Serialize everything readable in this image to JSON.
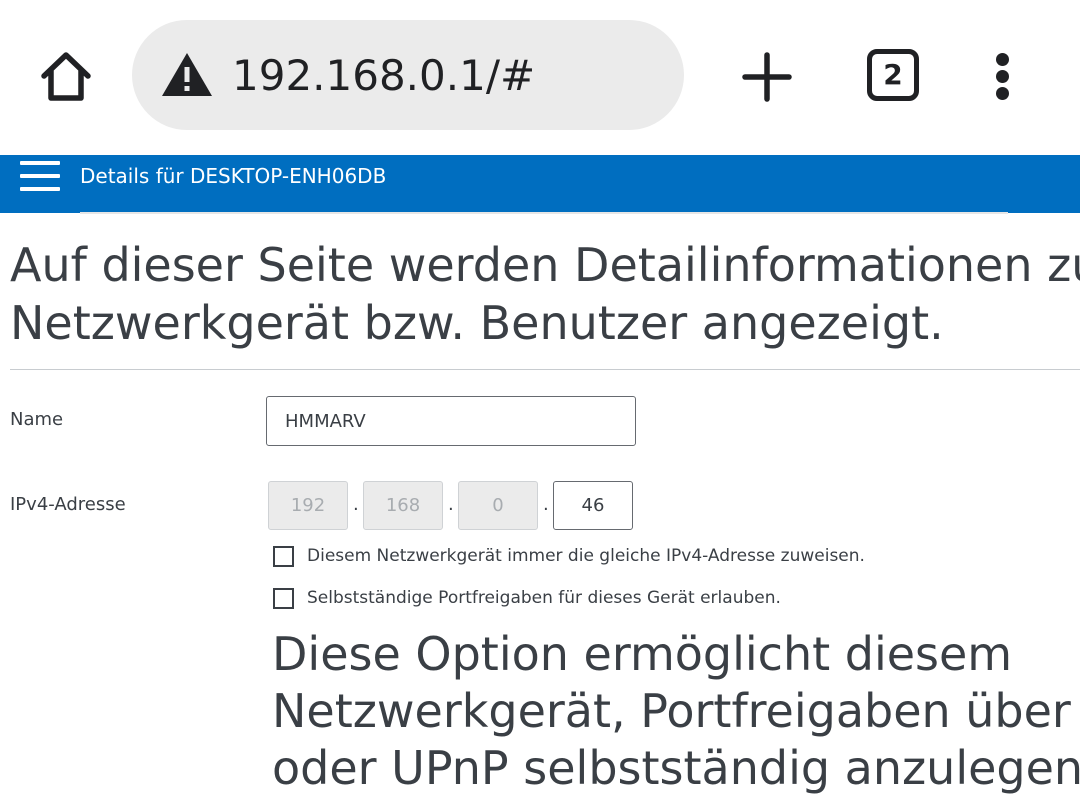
{
  "browser": {
    "url": "192.168.0.1/#",
    "tab_count": "2",
    "icons": [
      "home-icon",
      "warning-icon",
      "plus-icon",
      "tabs-icon",
      "more-vert-icon"
    ]
  },
  "header": {
    "title": "Details für DESKTOP-ENH06DB",
    "color": "#006ec0"
  },
  "intro": {
    "line1": "Auf dieser Seite werden Detailinformationen zur",
    "line2": "Netzwerkgerät bzw. Benutzer angezeigt."
  },
  "form": {
    "name_label": "Name",
    "name_value": "HMMARV",
    "ipv4_label": "IPv4-Adresse",
    "ip": [
      "192",
      "168",
      "0",
      "46"
    ],
    "ip_separator": ".",
    "checkbox_fixed_ip": "Diesem Netzwerkgerät immer die gleiche IPv4-Adresse zuweisen.",
    "checkbox_fixed_ip_checked": false,
    "checkbox_port": "Selbstständige Portfreigaben für dieses Gerät erlauben.",
    "checkbox_port_checked": false
  },
  "help": {
    "line1": "Diese Option ermöglicht diesem",
    "line2": "Netzwerkgerät, Portfreigaben über P",
    "line3": "oder UPnP selbstständig anzulegen."
  }
}
